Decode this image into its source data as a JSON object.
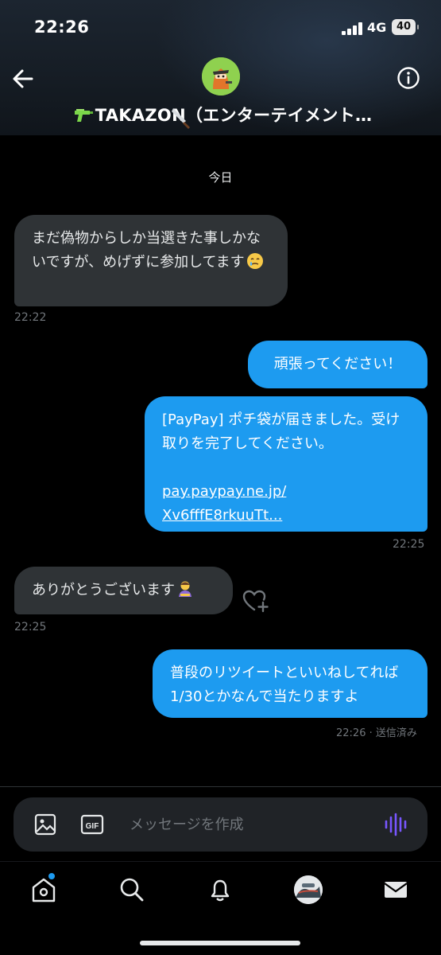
{
  "status_bar": {
    "time": "22:26",
    "network": "4G",
    "battery": "40"
  },
  "header": {
    "title": "TAKAZON（エンターテイメント…",
    "back_icon": "arrow-left-icon",
    "info_icon": "info-icon",
    "title_prefix_icon": "water-pistol-icon",
    "title_suffix_icon": "knife-icon"
  },
  "conversation": {
    "day_label": "今日",
    "messages": [
      {
        "direction": "in",
        "text": "まだ偽物からしか当選きた事しかないですが、めげずに参加してます",
        "emoji": "holding-back-tears-emoji",
        "time": "22:22"
      },
      {
        "direction": "out",
        "text": "頑張ってください！"
      },
      {
        "direction": "out",
        "text": "[PayPay] ポチ袋が届きました。受け取りを完了してください。",
        "link": "pay.paypay.ne.jp/Xv6fffE8rkuuTt...",
        "time": "22:25"
      },
      {
        "direction": "in",
        "text": "ありがとうございます",
        "emoji": "bowing-person-emoji",
        "time": "22:25"
      },
      {
        "direction": "out",
        "text": "普段のリツイートといいねしてれば1/30とかなんで当たりますよ",
        "time": "22:26",
        "status": "送信済み"
      }
    ],
    "link_line1": "pay.paypay.ne.jp/",
    "link_line2": "Xv6fffE8rkuuTt...",
    "msg5_meta": "22:26 · 送信済み"
  },
  "composer": {
    "placeholder": "メッセージを作成",
    "image_icon": "image-icon",
    "gif_icon": "gif-icon",
    "voice_icon": "voice-waveform-icon"
  },
  "bottom_nav": {
    "items": [
      "home-icon",
      "search-icon",
      "bell-icon",
      "profile-avatar",
      "mail-icon"
    ]
  },
  "colors": {
    "accent": "#1d9bf0",
    "incoming_bubble": "#2f3336",
    "voice_icon": "#7856ff",
    "background": "#000000"
  }
}
